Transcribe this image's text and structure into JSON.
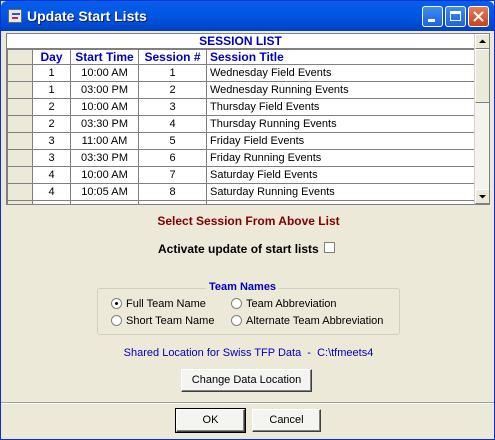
{
  "window": {
    "title": "Update Start Lists"
  },
  "grid": {
    "title": "SESSION LIST",
    "columns": [
      "Day",
      "Start Time",
      "Session #",
      "Session Title"
    ],
    "rows": [
      {
        "day": "1",
        "time": "10:00 AM",
        "session": "1",
        "title": "Wednesday Field Events"
      },
      {
        "day": "1",
        "time": "03:00 PM",
        "session": "2",
        "title": "Wednesday Running Events"
      },
      {
        "day": "2",
        "time": "10:00 AM",
        "session": "3",
        "title": "Thursday Field Events"
      },
      {
        "day": "2",
        "time": "03:30 PM",
        "session": "4",
        "title": "Thursday Running Events"
      },
      {
        "day": "3",
        "time": "11:00 AM",
        "session": "5",
        "title": "Friday Field Events"
      },
      {
        "day": "3",
        "time": "03:30 PM",
        "session": "6",
        "title": "Friday Running Events"
      },
      {
        "day": "4",
        "time": "10:00 AM",
        "session": "7",
        "title": "Saturday Field Events"
      },
      {
        "day": "4",
        "time": "10:05 AM",
        "session": "8",
        "title": "Saturday Running Events"
      }
    ]
  },
  "prompt": "Select Session From Above List",
  "activate_label": "Activate update of start lists",
  "activate_checked": false,
  "team_names": {
    "label": "Team Names",
    "options": [
      "Full Team Name",
      "Short Team Name",
      "Team Abbreviation",
      "Alternate Team Abbreviation"
    ],
    "selected": "Full Team Name"
  },
  "shared_location": "Shared Location for Swiss TFP Data  -  C:\\tfmeets4",
  "buttons": {
    "change_location": "Change Data Location",
    "ok": "OK",
    "cancel": "Cancel"
  },
  "colors": {
    "titlebar": "#0058e6",
    "header_text": "#0000c0",
    "prompt_text": "#800000",
    "face": "#ece9d8"
  }
}
